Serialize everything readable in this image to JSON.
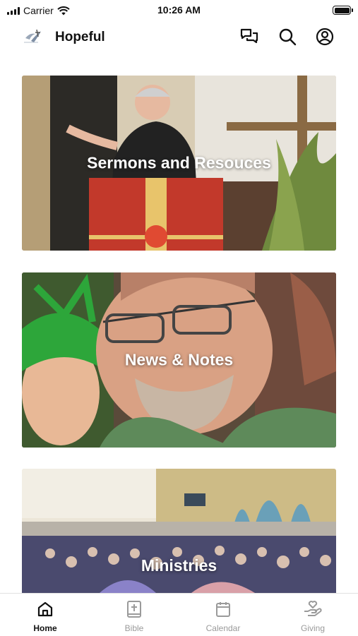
{
  "status_bar": {
    "carrier": "Carrier",
    "time": "10:26 AM"
  },
  "header": {
    "title": "Hopeful",
    "icons": [
      "chat-icon",
      "search-icon",
      "account-icon"
    ]
  },
  "cards": [
    {
      "title": "Sermons and Resouces"
    },
    {
      "title": "News & Notes"
    },
    {
      "title": "Ministries"
    }
  ],
  "tabs": [
    {
      "label": "Home",
      "icon": "home-icon",
      "active": true
    },
    {
      "label": "Bible",
      "icon": "bible-icon",
      "active": false
    },
    {
      "label": "Calendar",
      "icon": "calendar-icon",
      "active": false
    },
    {
      "label": "Giving",
      "icon": "giving-icon",
      "active": false
    }
  ],
  "colors": {
    "active_tab": "#111111",
    "inactive_tab": "#9a9a9a",
    "background": "#ffffff"
  }
}
